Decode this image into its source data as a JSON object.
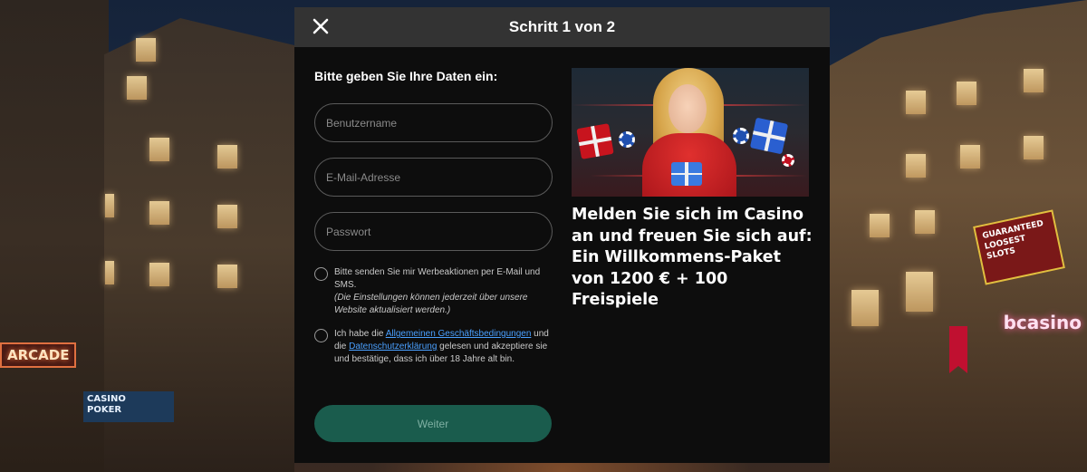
{
  "modal": {
    "title": "Schritt 1 von 2",
    "close_icon": "close-icon"
  },
  "form": {
    "heading": "Bitte geben Sie Ihre Daten ein:",
    "username_placeholder": "Benutzername",
    "email_placeholder": "E-Mail-Adresse",
    "password_placeholder": "Passwort",
    "marketing_consent": {
      "text": "Bitte senden Sie mir Werbeaktionen per E-Mail und SMS.",
      "note": "(Die Einstellungen können jederzeit über unsere Website aktualisiert werden.)",
      "checked": false
    },
    "terms_consent": {
      "prefix": "Ich habe die ",
      "terms_link": "Allgemeinen Geschäftsbedingungen",
      "middle": " und die ",
      "privacy_link": "Datenschutzerklärung",
      "suffix": " gelesen und akzeptiere sie und bestätige, dass ich über 18 Jahre alt bin.",
      "checked": false
    },
    "submit_label": "Weiter"
  },
  "promo": {
    "image": "casino-welcome-woman-with-gifts-image",
    "text": "Melden Sie sich im Casino an und freuen Sie sich auf: Ein Willkommens-Paket von 1200 € + 100 Freispiele"
  },
  "background": {
    "signs": {
      "arcade": "ARCADE",
      "casino_left": "CASINO",
      "poker": "POKER",
      "slots": "GUARANTEED LOOSEST SLOTS",
      "bcasino": "bcasino"
    }
  },
  "colors": {
    "modal_bg": "#0d0d0d",
    "header_bg": "#333333",
    "button_bg": "#1a5c4d",
    "link": "#4aa0ff"
  }
}
